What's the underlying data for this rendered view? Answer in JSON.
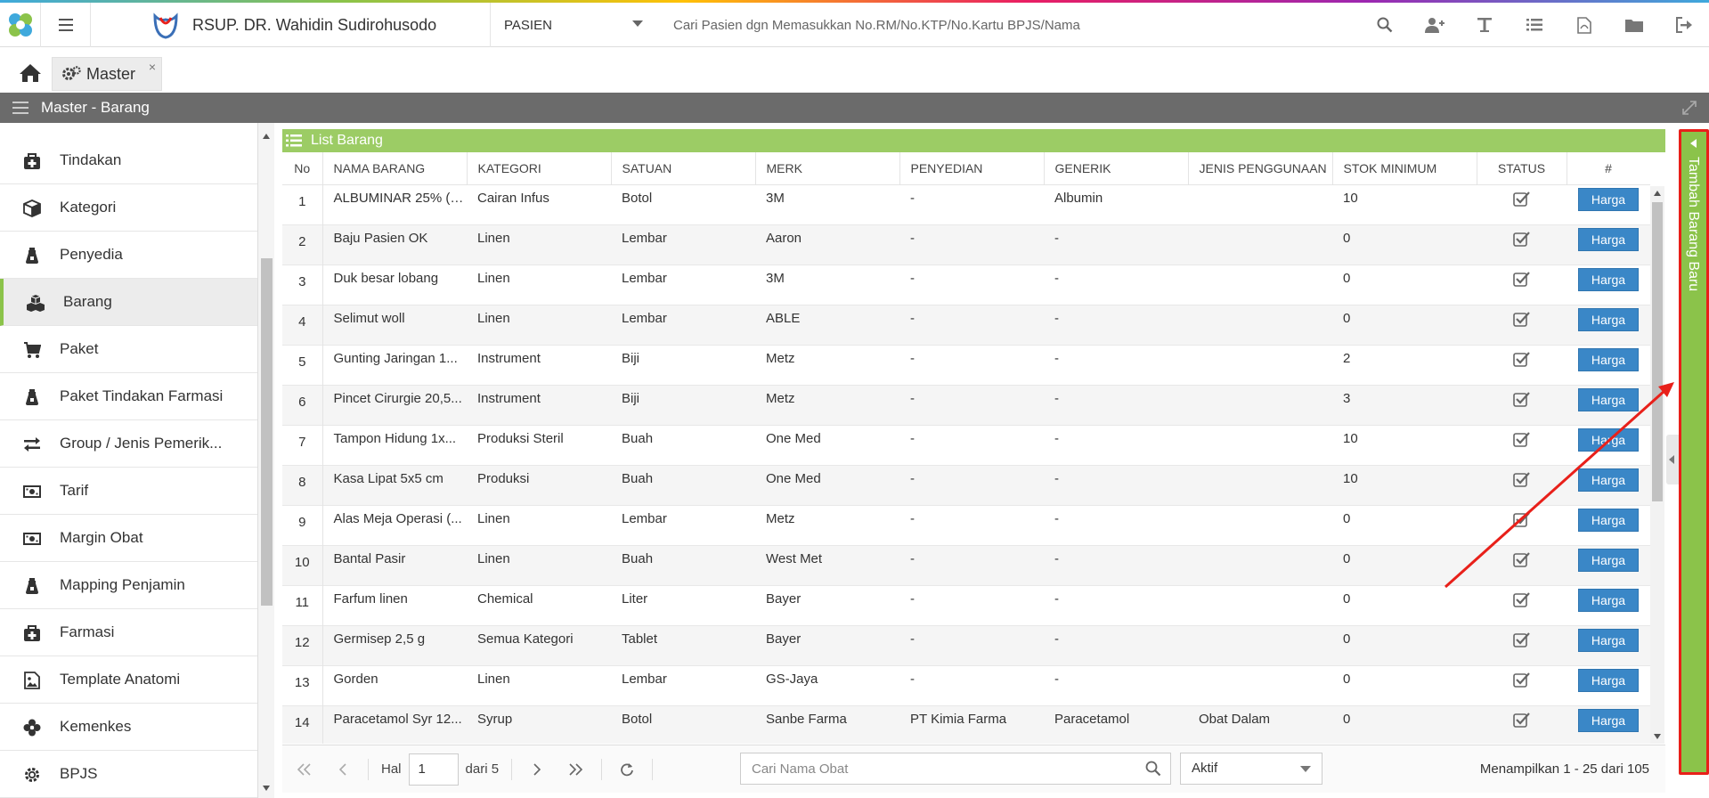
{
  "header": {
    "hospital_name": "RSUP. DR. Wahidin Sudirohusodo",
    "module_selected": "PASIEN",
    "patient_search_placeholder": "Cari Pasien dgn Memasukkan No.RM/No.KTP/No.Kartu BPJS/Nama",
    "icons": [
      "search-icon",
      "add-user-icon",
      "text-icon",
      "list-icon",
      "pdf-icon",
      "folder-icon",
      "logout-icon"
    ]
  },
  "tabs": {
    "master_label": "Master",
    "close_symbol": "×"
  },
  "title_bar": {
    "title": "Master - Barang"
  },
  "sidebar": {
    "items": [
      {
        "label": "Tindakan",
        "icon": "medkit-icon"
      },
      {
        "label": "Kategori",
        "icon": "cube-icon"
      },
      {
        "label": "Penyedia",
        "icon": "flask-icon"
      },
      {
        "label": "Barang",
        "icon": "cubes-icon",
        "active": true
      },
      {
        "label": "Paket",
        "icon": "cart-icon"
      },
      {
        "label": "Paket Tindakan Farmasi",
        "icon": "flask-icon"
      },
      {
        "label": "Group / Jenis Pemerik...",
        "icon": "exchange-icon"
      },
      {
        "label": "Tarif",
        "icon": "money-icon"
      },
      {
        "label": "Margin Obat",
        "icon": "money-icon"
      },
      {
        "label": "Mapping Penjamin",
        "icon": "flask-icon"
      },
      {
        "label": "Farmasi",
        "icon": "medkit-icon"
      },
      {
        "label": "Template Anatomi",
        "icon": "image-icon"
      },
      {
        "label": "Kemenkes",
        "icon": "flower-icon"
      },
      {
        "label": "BPJS",
        "icon": "gear-icon"
      }
    ]
  },
  "list": {
    "title": "List Barang",
    "columns": [
      "No",
      "NAMA BARANG",
      "KATEGORI",
      "SATUAN",
      "MERK",
      "PENYEDIAN",
      "GENERIK",
      "JENIS PENGGUNAAN",
      "STOK MINIMUM",
      "STATUS",
      "#"
    ],
    "action_label": "Harga",
    "rows": [
      {
        "no": "1",
        "nama": "ALBUMINAR 25% (A...",
        "kategori": "Cairan Infus",
        "satuan": "Botol",
        "merk": "3M",
        "penyedian": "-",
        "generik": "Albumin",
        "jenis": "",
        "stok": "10",
        "status": true
      },
      {
        "no": "2",
        "nama": "Baju Pasien OK",
        "kategori": "Linen",
        "satuan": "Lembar",
        "merk": "Aaron",
        "penyedian": "-",
        "generik": "-",
        "jenis": "",
        "stok": "0",
        "status": true
      },
      {
        "no": "3",
        "nama": "Duk besar lobang",
        "kategori": "Linen",
        "satuan": "Lembar",
        "merk": "3M",
        "penyedian": "-",
        "generik": "-",
        "jenis": "",
        "stok": "0",
        "status": true
      },
      {
        "no": "4",
        "nama": "Selimut woll",
        "kategori": "Linen",
        "satuan": "Lembar",
        "merk": "ABLE",
        "penyedian": "-",
        "generik": "-",
        "jenis": "",
        "stok": "0",
        "status": true
      },
      {
        "no": "5",
        "nama": "Gunting Jaringan 1...",
        "kategori": "Instrument",
        "satuan": "Biji",
        "merk": "Metz",
        "penyedian": "-",
        "generik": "-",
        "jenis": "",
        "stok": "2",
        "status": true
      },
      {
        "no": "6",
        "nama": "Pincet Cirurgie 20,5...",
        "kategori": "Instrument",
        "satuan": "Biji",
        "merk": "Metz",
        "penyedian": "-",
        "generik": "-",
        "jenis": "",
        "stok": "3",
        "status": true
      },
      {
        "no": "7",
        "nama": "Tampon Hidung 1x...",
        "kategori": "Produksi Steril",
        "satuan": "Buah",
        "merk": "One Med",
        "penyedian": "-",
        "generik": "-",
        "jenis": "",
        "stok": "10",
        "status": true
      },
      {
        "no": "8",
        "nama": "Kasa Lipat 5x5 cm",
        "kategori": "Produksi",
        "satuan": "Buah",
        "merk": "One Med",
        "penyedian": "-",
        "generik": "-",
        "jenis": "",
        "stok": "10",
        "status": true
      },
      {
        "no": "9",
        "nama": "Alas Meja Operasi (...",
        "kategori": "Linen",
        "satuan": "Lembar",
        "merk": "Metz",
        "penyedian": "-",
        "generik": "-",
        "jenis": "",
        "stok": "0",
        "status": true
      },
      {
        "no": "10",
        "nama": "Bantal Pasir",
        "kategori": "Linen",
        "satuan": "Buah",
        "merk": "West Met",
        "penyedian": "-",
        "generik": "-",
        "jenis": "",
        "stok": "0",
        "status": true
      },
      {
        "no": "11",
        "nama": "Farfum linen",
        "kategori": "Chemical",
        "satuan": "Liter",
        "merk": "Bayer",
        "penyedian": "-",
        "generik": "-",
        "jenis": "",
        "stok": "0",
        "status": true
      },
      {
        "no": "12",
        "nama": "Germisep 2,5 g",
        "kategori": "Semua Kategori",
        "satuan": "Tablet",
        "merk": "Bayer",
        "penyedian": "-",
        "generik": "-",
        "jenis": "",
        "stok": "0",
        "status": true
      },
      {
        "no": "13",
        "nama": "Gorden",
        "kategori": "Linen",
        "satuan": "Lembar",
        "merk": "GS-Jaya",
        "penyedian": "-",
        "generik": "-",
        "jenis": "",
        "stok": "0",
        "status": true
      },
      {
        "no": "14",
        "nama": "Paracetamol Syr 12...",
        "kategori": "Syrup",
        "satuan": "Botol",
        "merk": "Sanbe Farma",
        "penyedian": "PT Kimia Farma",
        "generik": "Paracetamol",
        "jenis": "Obat Dalam",
        "stok": "0",
        "status": true
      }
    ]
  },
  "pager": {
    "hal_label": "Hal",
    "page_value": "1",
    "of_label": "dari 5",
    "search_placeholder": "Cari Nama Obat",
    "status_value": "Aktif",
    "info": "Menampilkan 1 - 25 dari 105"
  },
  "add_panel": {
    "label": "Tambah Barang Baru"
  },
  "colors": {
    "accent_green": "#8bc34a",
    "header_green": "#9ccc65",
    "button_blue": "#3a87c7",
    "title_bar_gray": "#6b6b6b",
    "annotation_red": "#e8201a"
  }
}
